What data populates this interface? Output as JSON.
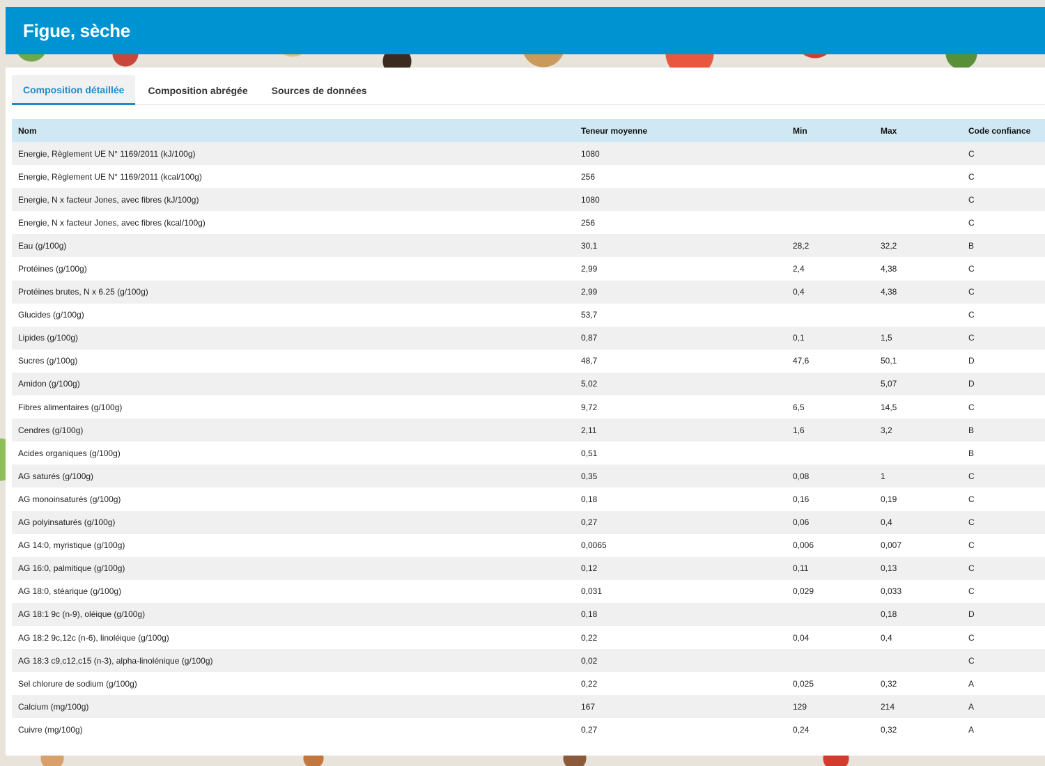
{
  "header": {
    "title": "Figue, sèche"
  },
  "tabs": [
    {
      "label": "Composition détaillée",
      "active": true
    },
    {
      "label": "Composition abrégée",
      "active": false
    },
    {
      "label": "Sources de données",
      "active": false
    }
  ],
  "table": {
    "columns": [
      "Nom",
      "Teneur moyenne",
      "Min",
      "Max",
      "Code confiance"
    ],
    "rows": [
      [
        "Energie, Règlement UE N° 1169/2011 (kJ/100g)",
        "1080",
        "",
        "",
        "C"
      ],
      [
        "Energie, Règlement UE N° 1169/2011 (kcal/100g)",
        "256",
        "",
        "",
        "C"
      ],
      [
        "Energie, N x facteur Jones, avec fibres (kJ/100g)",
        "1080",
        "",
        "",
        "C"
      ],
      [
        "Energie, N x facteur Jones, avec fibres (kcal/100g)",
        "256",
        "",
        "",
        "C"
      ],
      [
        "Eau (g/100g)",
        "30,1",
        "28,2",
        "32,2",
        "B"
      ],
      [
        "Protéines (g/100g)",
        "2,99",
        "2,4",
        "4,38",
        "C"
      ],
      [
        "Protéines brutes, N x 6.25 (g/100g)",
        "2,99",
        "0,4",
        "4,38",
        "C"
      ],
      [
        "Glucides (g/100g)",
        "53,7",
        "",
        "",
        "C"
      ],
      [
        "Lipides (g/100g)",
        "0,87",
        "0,1",
        "1,5",
        "C"
      ],
      [
        "Sucres (g/100g)",
        "48,7",
        "47,6",
        "50,1",
        "D"
      ],
      [
        "Amidon (g/100g)",
        "5,02",
        "",
        "5,07",
        "D"
      ],
      [
        "Fibres alimentaires (g/100g)",
        "9,72",
        "6,5",
        "14,5",
        "C"
      ],
      [
        "Cendres (g/100g)",
        "2,11",
        "1,6",
        "3,2",
        "B"
      ],
      [
        "Acides organiques (g/100g)",
        "0,51",
        "",
        "",
        "B"
      ],
      [
        "AG saturés (g/100g)",
        "0,35",
        "0,08",
        "1",
        "C"
      ],
      [
        "AG monoinsaturés (g/100g)",
        "0,18",
        "0,16",
        "0,19",
        "C"
      ],
      [
        "AG polyinsaturés (g/100g)",
        "0,27",
        "0,06",
        "0,4",
        "C"
      ],
      [
        "AG 14:0, myristique (g/100g)",
        "0,0065",
        "0,006",
        "0,007",
        "C"
      ],
      [
        "AG 16:0, palmitique (g/100g)",
        "0,12",
        "0,11",
        "0,13",
        "C"
      ],
      [
        "AG 18:0, stéarique (g/100g)",
        "0,031",
        "0,029",
        "0,033",
        "C"
      ],
      [
        "AG 18:1 9c (n-9), oléique (g/100g)",
        "0,18",
        "",
        "0,18",
        "D"
      ],
      [
        "AG 18:2 9c,12c (n-6), linoléique (g/100g)",
        "0,22",
        "0,04",
        "0,4",
        "C"
      ],
      [
        "AG 18:3 c9,c12,c15 (n-3), alpha-linolénique (g/100g)",
        "0,02",
        "",
        "",
        "C"
      ],
      [
        "Sel chlorure de sodium (g/100g)",
        "0,22",
        "0,025",
        "0,32",
        "A"
      ],
      [
        "Calcium (mg/100g)",
        "167",
        "129",
        "214",
        "A"
      ],
      [
        "Cuivre (mg/100g)",
        "0,27",
        "0,24",
        "0,32",
        "A"
      ]
    ]
  }
}
